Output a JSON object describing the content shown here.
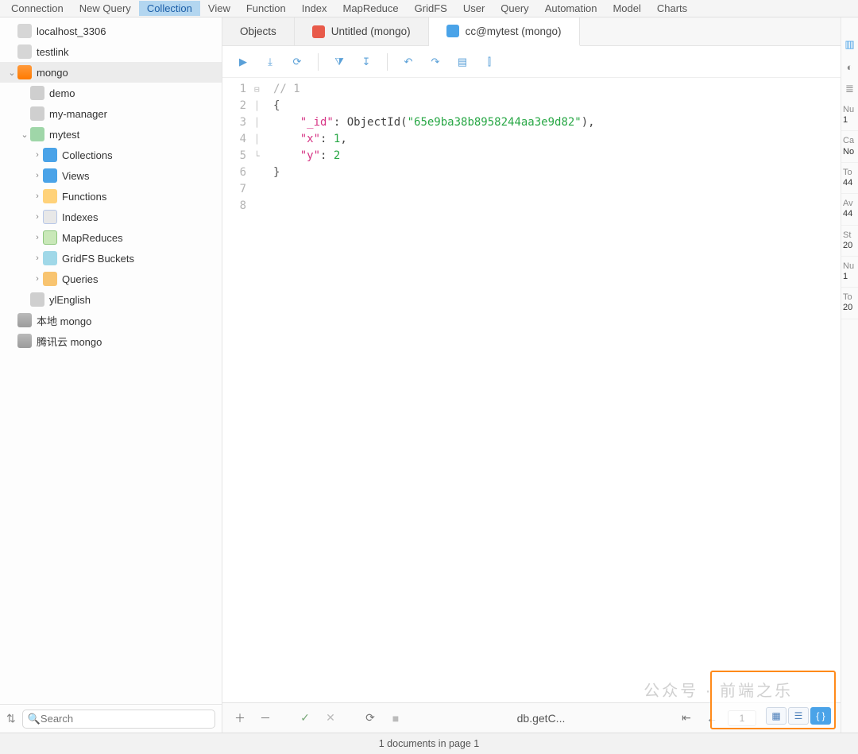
{
  "menubar": [
    "Connection",
    "New Query",
    "Collection",
    "View",
    "Function",
    "Index",
    "MapReduce",
    "GridFS",
    "User",
    "Query",
    "Automation",
    "Model",
    "Charts"
  ],
  "menubar_selected_index": 2,
  "sidebar": {
    "search_placeholder": "Search",
    "tree": [
      {
        "kind": "conn",
        "label": "localhost_3306",
        "indent": 0,
        "icon": "icon-conn"
      },
      {
        "kind": "conn",
        "label": "testlink",
        "indent": 0,
        "icon": "icon-conn"
      },
      {
        "kind": "conn",
        "label": "mongo",
        "indent": 0,
        "chev": "down",
        "icon": "icon-mongo",
        "sel": true
      },
      {
        "kind": "db",
        "label": "demo",
        "indent": 1,
        "icon": "icon-db-grey"
      },
      {
        "kind": "db",
        "label": "my-manager",
        "indent": 1,
        "icon": "icon-db-grey"
      },
      {
        "kind": "db",
        "label": "mytest",
        "indent": 1,
        "chev": "down",
        "icon": "icon-db"
      },
      {
        "kind": "folder",
        "label": "Collections",
        "indent": 2,
        "chev": "right",
        "icon": "icon-coll"
      },
      {
        "kind": "folder",
        "label": "Views",
        "indent": 2,
        "chev": "right",
        "icon": "icon-view"
      },
      {
        "kind": "folder",
        "label": "Functions",
        "indent": 2,
        "chev": "right",
        "icon": "icon-func"
      },
      {
        "kind": "folder",
        "label": "Indexes",
        "indent": 2,
        "chev": "right",
        "icon": "icon-idx"
      },
      {
        "kind": "folder",
        "label": "MapReduces",
        "indent": 2,
        "chev": "right",
        "icon": "icon-mr"
      },
      {
        "kind": "folder",
        "label": "GridFS Buckets",
        "indent": 2,
        "chev": "right",
        "icon": "icon-gfs"
      },
      {
        "kind": "folder",
        "label": "Queries",
        "indent": 2,
        "chev": "right",
        "icon": "icon-qry"
      },
      {
        "kind": "db",
        "label": "ylEnglish",
        "indent": 1,
        "icon": "icon-db-grey"
      },
      {
        "kind": "conn",
        "label": "本地 mongo",
        "indent": 0,
        "icon": "icon-mongo",
        "grey": true
      },
      {
        "kind": "conn",
        "label": "腾讯云 mongo",
        "indent": 0,
        "icon": "icon-mongo",
        "grey": true
      }
    ]
  },
  "tabs": [
    {
      "label": "Objects",
      "icon": null
    },
    {
      "label": "Untitled (mongo)",
      "icon": "tabicon-red"
    },
    {
      "label": "cc@mytest (mongo)",
      "icon": "tabicon-blue",
      "active": true
    }
  ],
  "toolbar_icons": [
    "db-play",
    "db-save",
    "db-refresh",
    "|",
    "filter",
    "sort",
    "|",
    "undo",
    "redo",
    "data-view",
    "chart"
  ],
  "editor": {
    "line_numbers": [
      "1",
      "2",
      "3",
      "4",
      "5",
      "6",
      "7",
      "8"
    ],
    "lines": [
      {
        "t": "cmt",
        "text": "// 1"
      },
      {
        "t": "brace",
        "text": "{"
      },
      {
        "t": "kv",
        "key": "\"_id\"",
        "between": ": ObjectId(",
        "val": "\"65e9ba38b8958244aa3e9d82\"",
        "after": "),"
      },
      {
        "t": "kv",
        "key": "\"x\"",
        "between": ": ",
        "val": "1",
        "after": ","
      },
      {
        "t": "kv",
        "key": "\"y\"",
        "between": ": ",
        "val": "2",
        "after": ""
      },
      {
        "t": "brace",
        "text": "}"
      },
      {
        "t": "empty",
        "text": ""
      },
      {
        "t": "empty",
        "text": ""
      }
    ]
  },
  "bottombar": {
    "add": "＋",
    "remove": "－",
    "check": "✓",
    "cancel": "✕",
    "reload": "⟳",
    "stop": "■",
    "center_text": "db.getC...",
    "page": "1",
    "view_buttons": [
      "grid",
      "tree",
      "json"
    ],
    "active_view": "json"
  },
  "status_text": "1 documents in page 1",
  "right_panel": {
    "items": [
      {
        "label": "Nu",
        "value": "1"
      },
      {
        "label": "Ca",
        "value": "No"
      },
      {
        "label": "To",
        "value": "44"
      },
      {
        "label": "Av",
        "value": "44"
      },
      {
        "label": "St",
        "value": "20"
      },
      {
        "label": "Nu",
        "value": "1"
      },
      {
        "label": "To",
        "value": "20"
      }
    ]
  },
  "watermark": "公众号 · 前端之乐"
}
